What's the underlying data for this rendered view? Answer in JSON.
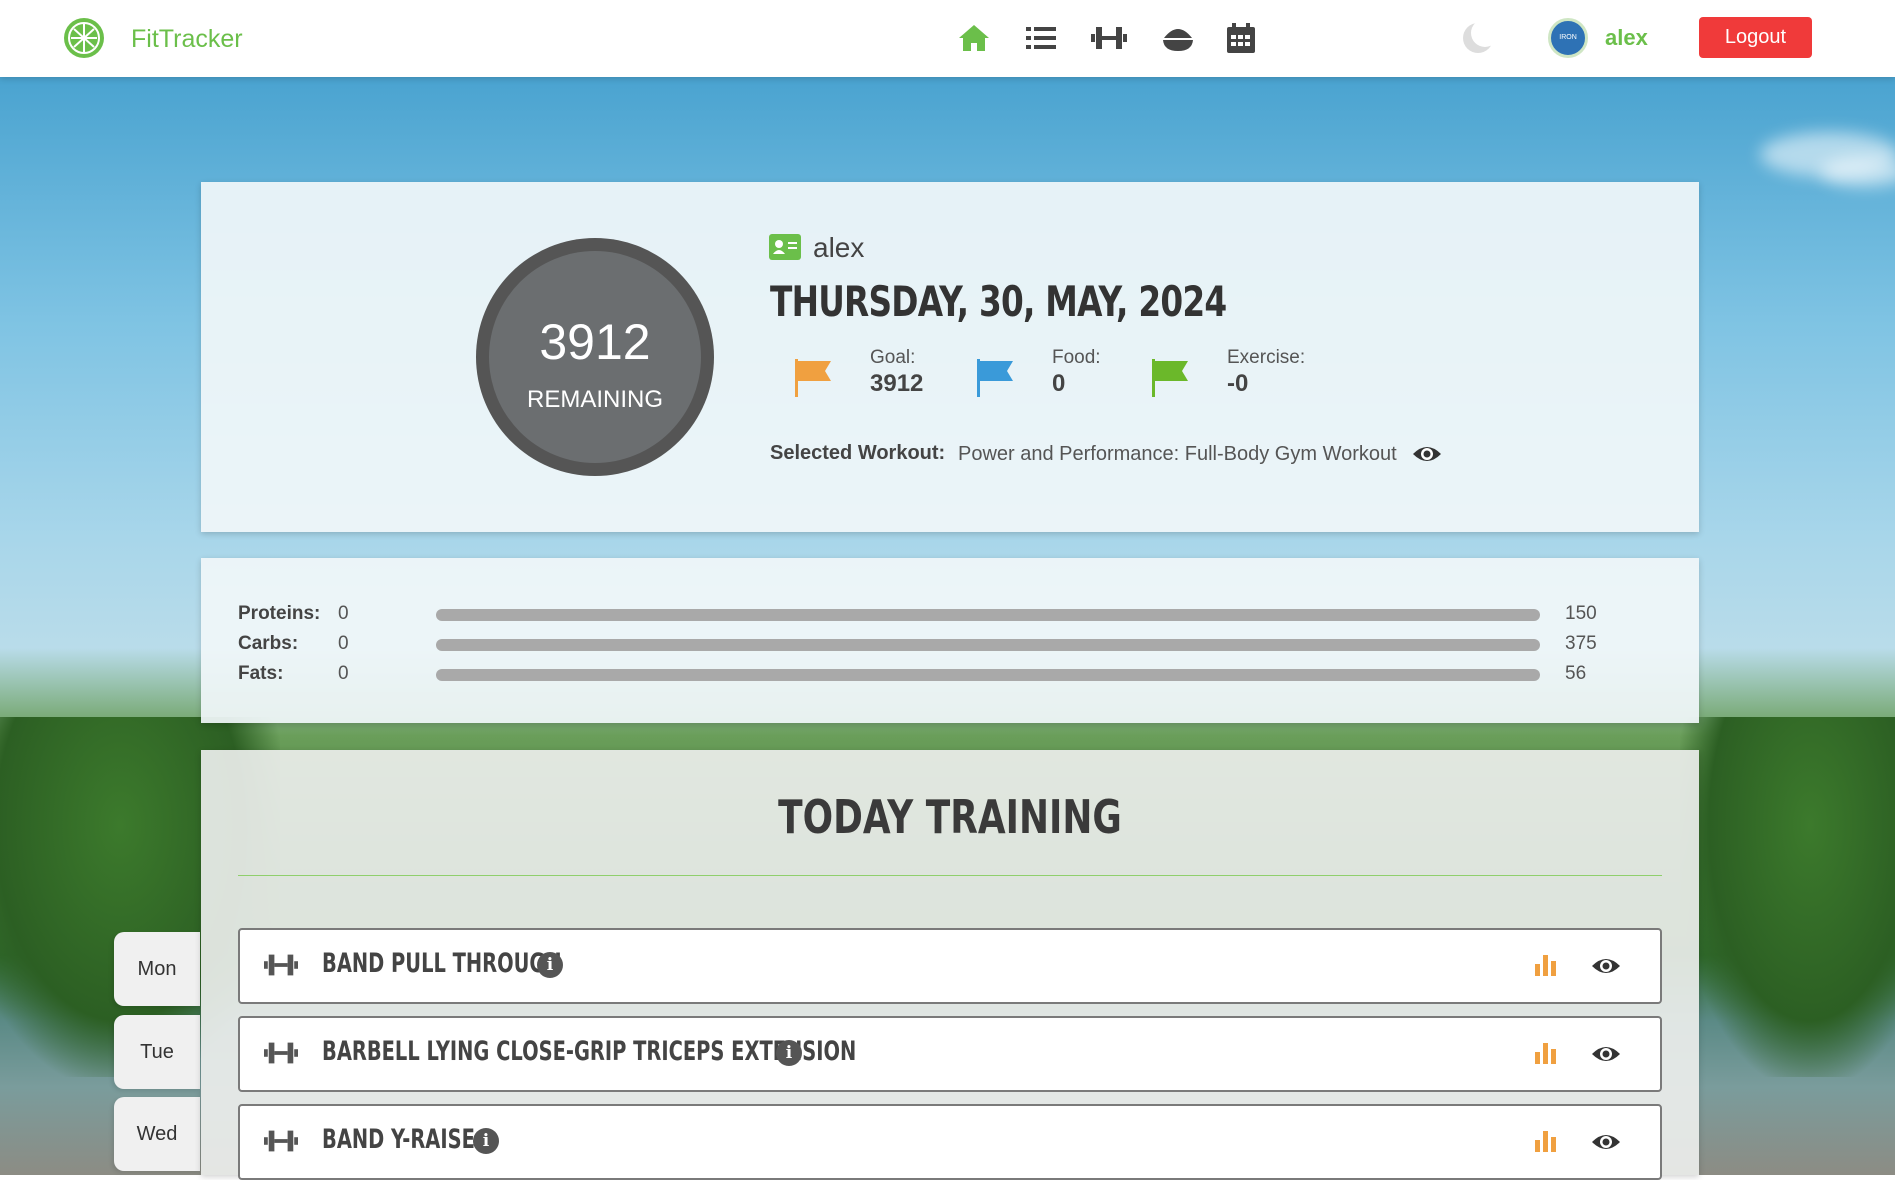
{
  "header": {
    "brand": "FitTracker",
    "nav_icons": [
      "home-icon",
      "list-icon",
      "dumbbell-icon",
      "food-bowl-icon",
      "calendar-icon"
    ],
    "avatar_text": "IRON",
    "username": "alex",
    "logout_label": "Logout"
  },
  "summary": {
    "remaining_value": "3912",
    "remaining_label": "REMAINING",
    "profile_name": "alex",
    "date": "THURSDAY, 30, MAY, 2024",
    "stats": [
      {
        "label": "Goal:",
        "value": "3912",
        "color": "#f0a040"
      },
      {
        "label": "Food:",
        "value": "0",
        "color": "#3a9ad9"
      },
      {
        "label": "Exercise:",
        "value": "-0",
        "color": "#6bb82a"
      }
    ],
    "selected_workout_label": "Selected Workout:",
    "selected_workout_value": "Power and Performance: Full-Body Gym Workout"
  },
  "macros": [
    {
      "name": "Proteins:",
      "value": "0",
      "max": "150",
      "fraction": 0
    },
    {
      "name": "Carbs:",
      "value": "0",
      "max": "375",
      "fraction": 0
    },
    {
      "name": "Fats:",
      "value": "0",
      "max": "56",
      "fraction": 0
    }
  ],
  "training": {
    "title": "TODAY TRAINING",
    "exercises": [
      {
        "name": "BAND PULL THROUGH"
      },
      {
        "name": "BARBELL LYING CLOSE-GRIP TRICEPS EXTENSION"
      },
      {
        "name": "BAND Y-RAISE"
      }
    ]
  },
  "days": [
    "Mon",
    "Tue",
    "Wed"
  ],
  "colors": {
    "accent": "#6bbf4a",
    "logout": "#f03a3a",
    "chart_icon": "#f0a040"
  }
}
